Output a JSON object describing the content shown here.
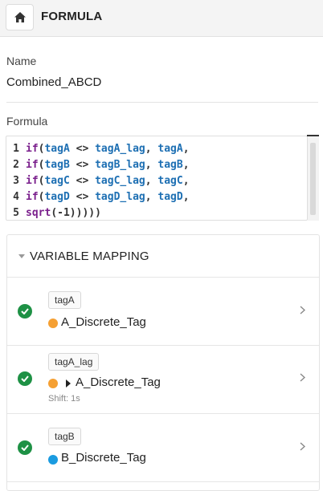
{
  "header": {
    "title": "FORMULA",
    "home_icon": "home-icon"
  },
  "name_field": {
    "label": "Name",
    "value": "Combined_ABCD"
  },
  "formula_field": {
    "label": "Formula",
    "lines": [
      {
        "num": "1",
        "tokens": [
          [
            "kw",
            "if"
          ],
          [
            "pn",
            "("
          ],
          [
            "id",
            "tagA"
          ],
          [
            "op",
            " <> "
          ],
          [
            "id",
            "tagA_lag"
          ],
          [
            "pn",
            ", "
          ],
          [
            "id",
            "tagA"
          ],
          [
            "pn",
            ","
          ]
        ]
      },
      {
        "num": "2",
        "tokens": [
          [
            "kw",
            "if"
          ],
          [
            "pn",
            "("
          ],
          [
            "id",
            "tagB"
          ],
          [
            "op",
            " <> "
          ],
          [
            "id",
            "tagB_lag"
          ],
          [
            "pn",
            ", "
          ],
          [
            "id",
            "tagB"
          ],
          [
            "pn",
            ","
          ]
        ]
      },
      {
        "num": "3",
        "tokens": [
          [
            "kw",
            "if"
          ],
          [
            "pn",
            "("
          ],
          [
            "id",
            "tagC"
          ],
          [
            "op",
            " <> "
          ],
          [
            "id",
            "tagC_lag"
          ],
          [
            "pn",
            ", "
          ],
          [
            "id",
            "tagC"
          ],
          [
            "pn",
            ","
          ]
        ]
      },
      {
        "num": "4",
        "tokens": [
          [
            "kw",
            "if"
          ],
          [
            "pn",
            "("
          ],
          [
            "id",
            "tagD"
          ],
          [
            "op",
            " <> "
          ],
          [
            "id",
            "tagD_lag"
          ],
          [
            "pn",
            ", "
          ],
          [
            "id",
            "tagD"
          ],
          [
            "pn",
            ","
          ]
        ]
      },
      {
        "num": "5",
        "tokens": [
          [
            "kw",
            "sqrt"
          ],
          [
            "pn",
            "("
          ],
          [
            "num",
            "-1"
          ],
          [
            "pn",
            "))))"
          ],
          [
            "pn",
            ")"
          ]
        ]
      }
    ]
  },
  "variable_mapping": {
    "title": "VARIABLE MAPPING",
    "rows": [
      {
        "variable": "tagA",
        "source": "A_Discrete_Tag",
        "dot_color": "#f5a033",
        "lagged": false,
        "shift": ""
      },
      {
        "variable": "tagA_lag",
        "source": "A_Discrete_Tag",
        "dot_color": "#f5a033",
        "lagged": true,
        "shift": "Shift: 1s"
      },
      {
        "variable": "tagB",
        "source": "B_Discrete_Tag",
        "dot_color": "#1a9be0",
        "lagged": false,
        "shift": ""
      }
    ]
  },
  "colors": {
    "check_green": "#1e9145",
    "keyword": "#7a1f8c",
    "identifier": "#1d6fb3"
  }
}
